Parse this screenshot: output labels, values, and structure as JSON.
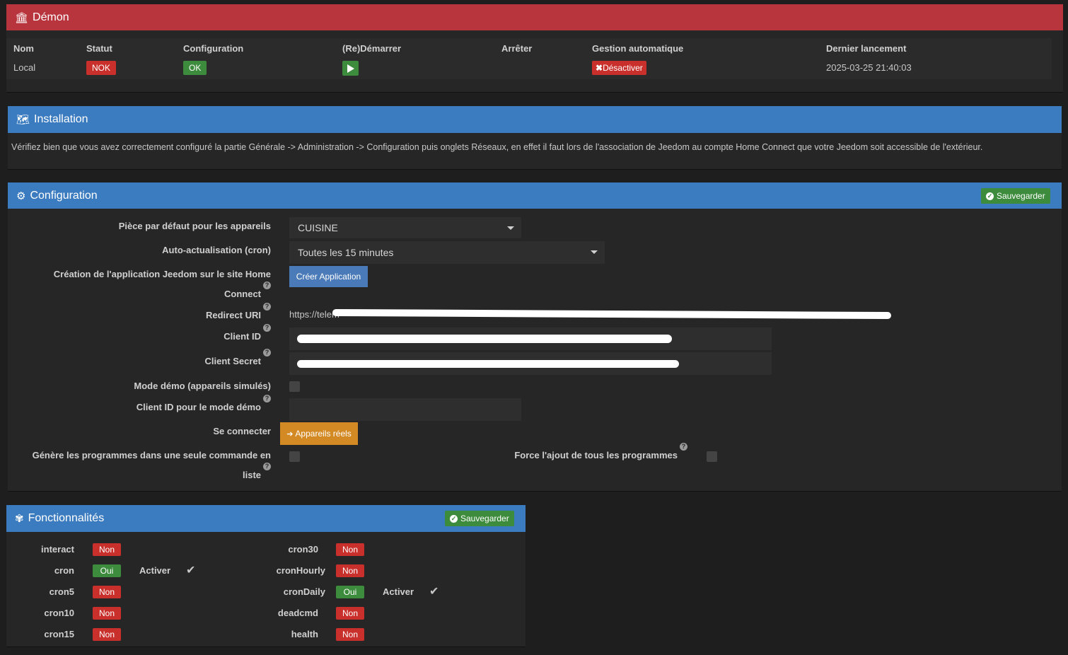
{
  "daemon": {
    "title": "Démon",
    "columns": [
      "Nom",
      "Statut",
      "Configuration",
      "(Re)Démarrer",
      "Arrêter",
      "Gestion automatique",
      "Dernier lancement"
    ],
    "row": {
      "name": "Local",
      "status": "NOK",
      "configuration": "OK",
      "auto_management_button": "Désactiver",
      "last_launch": "2025-03-25 21:40:03"
    }
  },
  "installation": {
    "title": "Installation",
    "text": "Vérifiez bien que vous avez correctement configuré la partie Générale -> Administration -> Configuration puis onglets Réseaux, en effet il faut lors de l'association de Jeedom au compte Home Connect que votre Jeedom soit accessible de l'extérieur."
  },
  "configuration": {
    "title": "Configuration",
    "save_label": "Sauvegarder",
    "default_room_label": "Pièce par défaut pour les appareils",
    "default_room_value": "CUISINE",
    "cron_label": "Auto-actualisation (cron)",
    "cron_value": "Toutes les 15 minutes",
    "create_app_label_line1": "Création de l'application Jeedom sur le site Home",
    "create_app_label_line2": "Connect",
    "create_app_button": "Créer Application",
    "redirect_uri_label": "Redirect URI",
    "redirect_uri_value": "https://telem",
    "client_id_label": "Client ID",
    "client_secret_label": "Client Secret",
    "demo_mode_label": "Mode démo (appareils simulés)",
    "demo_client_id_label": "Client ID pour le mode démo",
    "connect_label": "Se connecter",
    "connect_button": "Appareils réels",
    "single_command_label_line1": "Génère les programmes dans une seule commande en",
    "single_command_label_line2": "liste",
    "force_programs_label": "Force l'ajout de tous les programmes"
  },
  "features": {
    "title": "Fonctionnalités",
    "save_label": "Sauvegarder",
    "activate_label": "Activer",
    "left": [
      {
        "name": "interact",
        "value": "Non",
        "state": "off"
      },
      {
        "name": "cron",
        "value": "Oui",
        "state": "on"
      },
      {
        "name": "cron5",
        "value": "Non",
        "state": "off"
      },
      {
        "name": "cron10",
        "value": "Non",
        "state": "off"
      },
      {
        "name": "cron15",
        "value": "Non",
        "state": "off"
      }
    ],
    "right": [
      {
        "name": "cron30",
        "value": "Non",
        "state": "off"
      },
      {
        "name": "cronHourly",
        "value": "Non",
        "state": "off"
      },
      {
        "name": "cronDaily",
        "value": "Oui",
        "state": "on"
      },
      {
        "name": "deadcmd",
        "value": "Non",
        "state": "off"
      },
      {
        "name": "health",
        "value": "Non",
        "state": "off"
      }
    ]
  },
  "colors": {
    "red_header": "#b8353d",
    "blue_header": "#3b7bbf",
    "badge_red": "#c9302c",
    "badge_green": "#3d8b3d",
    "connect_button": "#d48a24",
    "create_button": "#4a7ab8"
  }
}
